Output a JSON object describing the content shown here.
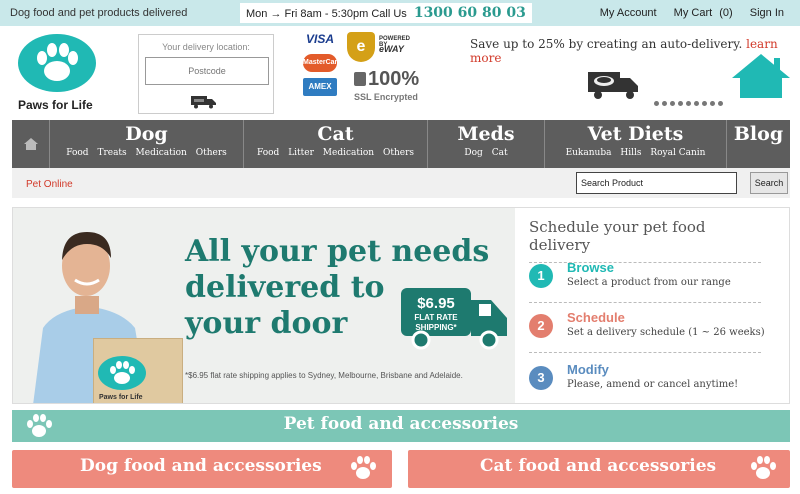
{
  "topbar": {
    "tagline": "Dog food and pet products delivered",
    "hours": "Mon → Fri 8am - 5:30pm Call Us",
    "phone": "1300 60 80 03",
    "links": {
      "account": "My Account",
      "cart": "My Cart",
      "cart_count": "(0)",
      "signin": "Sign In"
    }
  },
  "brand": {
    "name": "Paws for Life"
  },
  "delivery": {
    "label": "Your delivery location:",
    "postcode_placeholder": "Postcode"
  },
  "payment": {
    "visa": "VISA",
    "mastercard": "MasterCard",
    "amex": "AMEX",
    "eway_powered": "POWERED BY",
    "eway": "eWAY",
    "ssl_pct": "100%",
    "ssl_text": "SSL Encrypted"
  },
  "promo": {
    "text": "Save up to 25% by creating an auto-delivery.",
    "link": "learn more"
  },
  "nav": [
    {
      "title": "Dog",
      "subs": [
        "Food",
        "Treats",
        "Medication",
        "Others"
      ]
    },
    {
      "title": "Cat",
      "subs": [
        "Food",
        "Litter",
        "Medication",
        "Others"
      ]
    },
    {
      "title": "Meds",
      "subs": [
        "Dog",
        "Cat"
      ]
    },
    {
      "title": "Vet Diets",
      "subs": [
        "Eukanuba",
        "Hills",
        "Royal Canin"
      ]
    },
    {
      "title": "Blog",
      "subs": []
    }
  ],
  "subbar": {
    "pet_online": "Pet Online",
    "search_value": "Search Product",
    "search_button": "Search"
  },
  "banner": {
    "headline_1": "All your pet needs",
    "headline_2": "delivered to",
    "headline_3": "your door",
    "truck_price": "$6.95",
    "truck_text_1": "FLAT RATE",
    "truck_text_2": "SHIPPING*",
    "footnote": "*$6.95 flat rate shipping applies to Sydney, Melbourne, Brisbane and Adelaide.",
    "box_brand": "Paws for Life"
  },
  "schedule": {
    "title": "Schedule your pet food delivery",
    "steps": [
      {
        "num": "1",
        "heading": "Browse",
        "desc": "Select a product from our range",
        "color": "#20b9b4"
      },
      {
        "num": "2",
        "heading": "Schedule",
        "desc": "Set a delivery schedule (1 ~ 26 weeks)",
        "color": "#e37e6e"
      },
      {
        "num": "3",
        "heading": "Modify",
        "desc": "Please, amend or cancel anytime!",
        "color": "#5a8cbf"
      }
    ]
  },
  "sections": {
    "pet_food": "Pet food and accessories",
    "dog_food": "Dog food and accessories",
    "cat_food": "Cat food and accessories"
  },
  "colors": {
    "teal": "#20b9b4",
    "nav": "#5d5d5d",
    "coral": "#ee8a7d",
    "mint": "#7cc6b6",
    "topbar": "#c9e8ea"
  },
  "icons": [
    "home-icon",
    "paw-icon",
    "truck-icon",
    "house-icon",
    "lock-icon"
  ]
}
